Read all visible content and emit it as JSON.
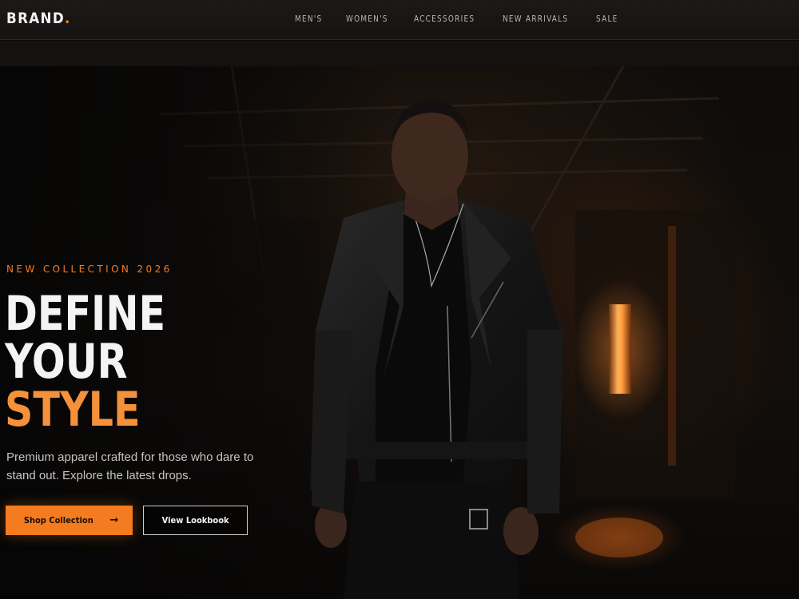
{
  "header": {
    "brand": "BRAND",
    "brand_dot": ".",
    "nav": [
      {
        "label": "MEN'S"
      },
      {
        "label": "WOMEN'S"
      },
      {
        "label": "ACCESSORIES"
      },
      {
        "label": "NEW ARRIVALS"
      },
      {
        "label": "SALE"
      }
    ]
  },
  "hero": {
    "eyebrow": "NEW COLLECTION 2026",
    "headline": [
      "DEFINE",
      "YOUR",
      "STYLE"
    ],
    "subcopy": "Premium apparel crafted for those who dare to stand out. Explore the latest drops.",
    "primary_button": "Shop Collection",
    "primary_icon": "arrow-right-icon",
    "secondary_button": "View Lookbook"
  },
  "colors": {
    "accent": "#f47b20",
    "headline_accent": "#f4913a",
    "background": "#0b0b0b",
    "text": "#f4f4f4"
  }
}
